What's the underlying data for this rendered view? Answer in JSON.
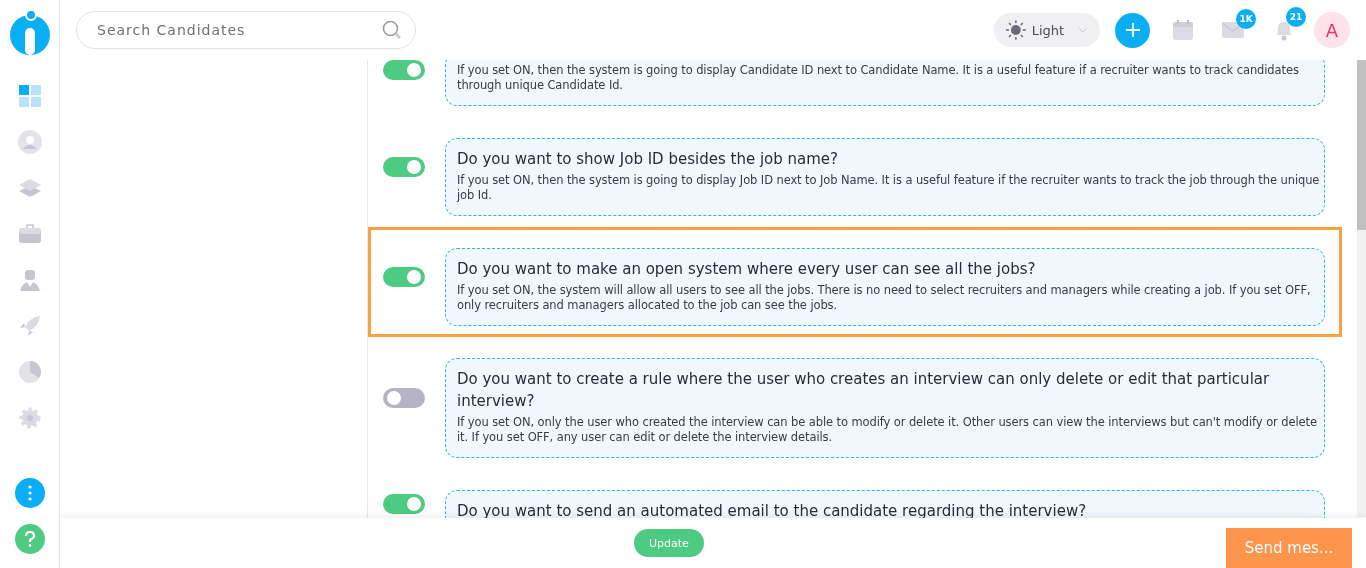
{
  "header": {
    "search": {
      "placeholder": "Search Candidates"
    },
    "theme": {
      "label": "Light"
    },
    "mail_badge": "1K",
    "notification_badge": "21",
    "avatar": "A"
  },
  "sidebar": {
    "items": [
      {
        "kind": "dashboard",
        "selected": true
      },
      {
        "kind": "person",
        "selected": false
      },
      {
        "kind": "layers",
        "selected": false
      },
      {
        "kind": "briefcase",
        "selected": false
      },
      {
        "kind": "user",
        "selected": false
      },
      {
        "kind": "rocket",
        "selected": false
      },
      {
        "kind": "pie",
        "selected": false
      },
      {
        "kind": "gear",
        "selected": false
      }
    ]
  },
  "settings": [
    {
      "description": "If you set ON, then the system is going to display Candidate ID next to Candidate Name. It is a useful feature if a recruiter wants to track candidates through unique Candidate Id.",
      "on": true,
      "highlighted": false
    },
    {
      "title": "Do you want to show Job ID besides the job name?",
      "description": "If you set ON, then the system is going to display Job ID next to Job Name. It is a useful feature if the recruiter wants to track the job through the unique job Id.",
      "on": true,
      "highlighted": false
    },
    {
      "title": "Do you want to make an open system where every user can see all the jobs?",
      "description": "If you set ON, the system will allow all users to see all the jobs. There is no need to select recruiters and managers while creating a job. If you set OFF, only recruiters and managers allocated to the job can see the jobs.",
      "on": true,
      "highlighted": true
    },
    {
      "title": "Do you want to create a rule where the user who creates an interview can only delete or edit that particular interview?",
      "description": "If you set ON, only the user who created the interview can be able to modify or delete it. Other users can view the interviews but can't modify or delete it. If you set OFF, any user can edit or delete the interview details.",
      "on": false,
      "highlighted": false
    },
    {
      "title": "Do you want to send an automated email to the candidate regarding the interview?",
      "on": true,
      "highlighted": false
    }
  ],
  "footer": {
    "update_button": "Update",
    "chat_button": "Send mes..."
  }
}
